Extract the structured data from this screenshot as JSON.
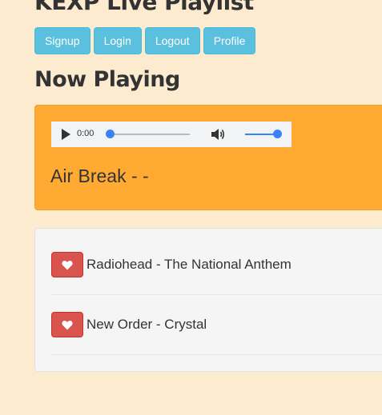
{
  "app": {
    "title": "KEXP Live Playlist"
  },
  "nav": {
    "buttons": [
      {
        "label": "Signup"
      },
      {
        "label": "Login"
      },
      {
        "label": "Logout"
      },
      {
        "label": "Profile"
      }
    ]
  },
  "now_playing": {
    "heading": "Now Playing",
    "player": {
      "time": "0:00",
      "play_icon": "play-icon",
      "volume_icon": "volume-icon",
      "progress": 0.0,
      "volume": 1.0
    },
    "current_track": "Air Break - -"
  },
  "playlist": {
    "items": [
      {
        "text": "Radiohead - The National Anthem",
        "icon": "heart-icon"
      },
      {
        "text": "New Order - Crystal",
        "icon": "heart-icon"
      }
    ]
  },
  "colors": {
    "background": "#fdebd0",
    "nav_button": "#5bc0de",
    "now_playing_panel": "#ffab33",
    "favorite_button": "#d9534f",
    "slider_accent": "#3b82f6"
  }
}
